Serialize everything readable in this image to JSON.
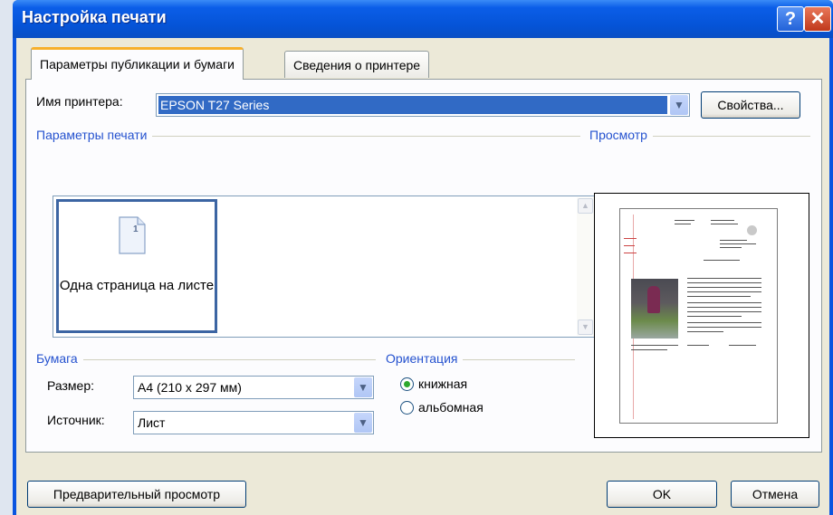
{
  "window": {
    "title": "Настройка печати"
  },
  "titlebar": {
    "help_label": "?",
    "close_label": "✕"
  },
  "tabs": [
    {
      "label": "Параметры публикации и бумаги",
      "active": true
    },
    {
      "label": "Сведения о принтере",
      "active": false
    }
  ],
  "printer": {
    "label": "Имя принтера:",
    "value": "EPSON T27 Series",
    "properties_button": "Свойства..."
  },
  "print_options": {
    "group_label": "Параметры печати",
    "page_icon_number": "1",
    "selected_option": "Одна страница на листе"
  },
  "preview": {
    "group_label": "Просмотр"
  },
  "paper": {
    "group_label": "Бумага",
    "size_label": "Размер:",
    "size_value": "A4 (210 x 297 мм)",
    "source_label": "Источник:",
    "source_value": "Лист"
  },
  "orientation": {
    "group_label": "Ориентация",
    "options": [
      {
        "label": "книжная",
        "checked": true
      },
      {
        "label": "альбомная",
        "checked": false
      }
    ]
  },
  "footer": {
    "preview_button": "Предварительный просмотр",
    "ok_button": "OK",
    "cancel_button": "Отмена"
  },
  "colors": {
    "title_bar": "#0553d6",
    "group_label": "#2552cf",
    "selection": "#316ac5",
    "tab_highlight": "#f7b02c"
  }
}
